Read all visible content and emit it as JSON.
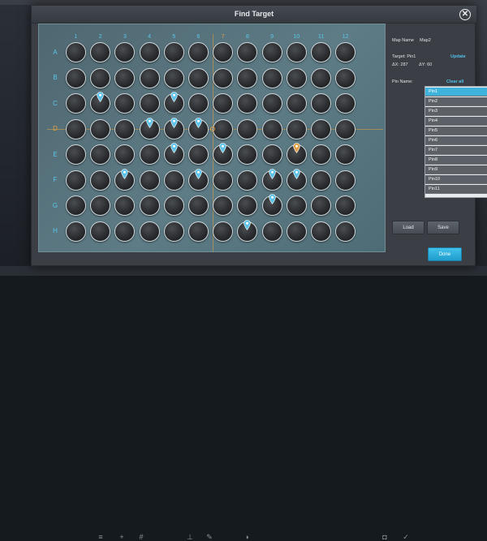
{
  "dialog": {
    "title": "Find Target",
    "close_symbol": "✕"
  },
  "plate": {
    "columns": [
      "1",
      "2",
      "3",
      "4",
      "5",
      "6",
      "7",
      "8",
      "9",
      "10",
      "11",
      "12"
    ],
    "rows": [
      "A",
      "B",
      "C",
      "D",
      "E",
      "F",
      "G",
      "H"
    ],
    "highlight_column": "7",
    "highlight_row": "D",
    "pins": [
      {
        "row": "C",
        "col": "2",
        "color": "#5cc4ea"
      },
      {
        "row": "C",
        "col": "5",
        "color": "#5cc4ea"
      },
      {
        "row": "D",
        "col": "4",
        "color": "#5cc4ea"
      },
      {
        "row": "D",
        "col": "5",
        "color": "#5cc4ea"
      },
      {
        "row": "D",
        "col": "6",
        "color": "#5cc4ea"
      },
      {
        "row": "E",
        "col": "5",
        "color": "#5cc4ea"
      },
      {
        "row": "E",
        "col": "7",
        "color": "#5cc4ea"
      },
      {
        "row": "E",
        "col": "10",
        "color": "#e0a043"
      },
      {
        "row": "F",
        "col": "3",
        "color": "#5cc4ea"
      },
      {
        "row": "F",
        "col": "6",
        "color": "#5cc4ea"
      },
      {
        "row": "F",
        "col": "9",
        "color": "#5cc4ea"
      },
      {
        "row": "F",
        "col": "10",
        "color": "#5cc4ea"
      },
      {
        "row": "G",
        "col": "9",
        "color": "#5cc4ea"
      },
      {
        "row": "H",
        "col": "8",
        "color": "#5cc4ea"
      }
    ]
  },
  "side": {
    "map_name_label": "Map Name",
    "map_name_value": "Map2",
    "target_label": "Target: Pin1",
    "dx": "ΔX: 287",
    "dy": "ΔY: 60",
    "update_label": "Update",
    "pin_name_label": "Pin Name:",
    "clear_all_label": "Clear all",
    "pins": [
      "Pin1",
      "Pin2",
      "Pin3",
      "Pin4",
      "Pin5",
      "Pin6",
      "Pin7",
      "Pin8",
      "Pin9",
      "Pin10",
      "Pin11"
    ],
    "selected_pin": "Pin1",
    "load_label": "Load",
    "save_label": "Save",
    "done_label": "Done"
  },
  "colors": {
    "accent": "#3fb3dc",
    "highlight": "#e0a043",
    "pin": "#5cc4ea"
  }
}
